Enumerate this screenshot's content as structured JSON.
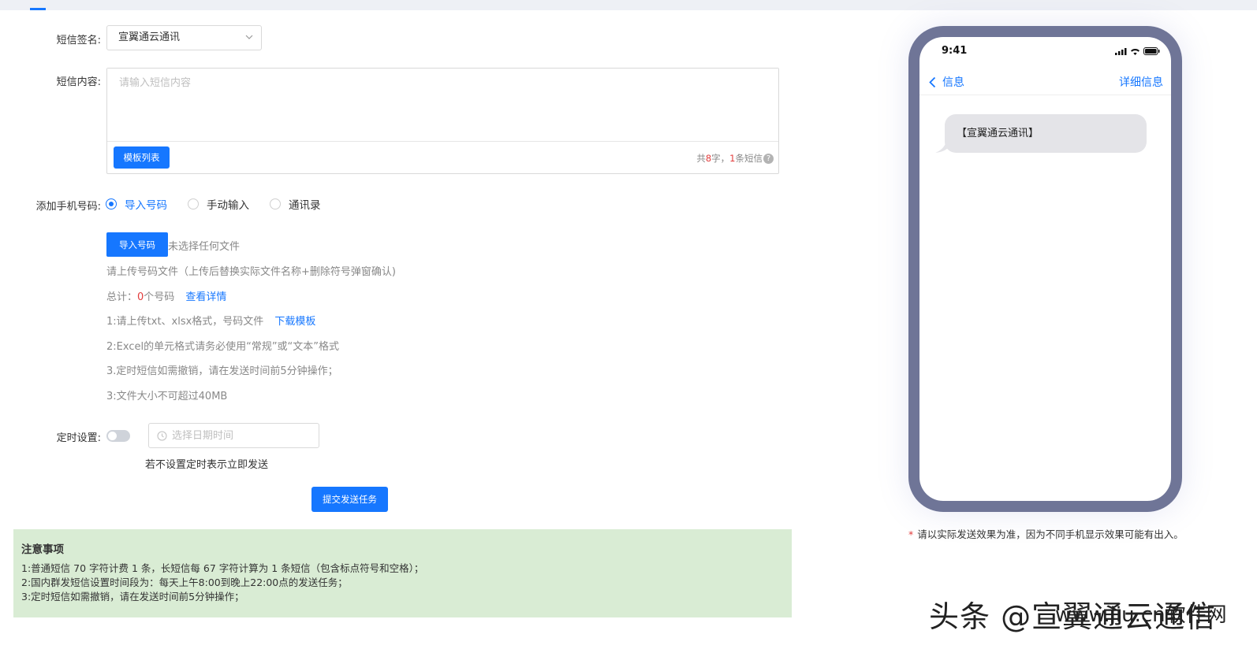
{
  "form": {
    "signature": {
      "label": "短信签名:",
      "value": "宣翼通云通讯"
    },
    "content": {
      "label": "短信内容:",
      "placeholder": "请输入短信内容",
      "template_button": "模板列表",
      "counter": {
        "prefix": "共",
        "chars": "8",
        "mid": " 字，",
        "messages": "1",
        "suffix": " 条短信"
      }
    },
    "phone_numbers": {
      "label": "添加手机号码:",
      "options": [
        {
          "label": "导入号码",
          "checked": true
        },
        {
          "label": "手动输入",
          "checked": false
        },
        {
          "label": "通讯录",
          "checked": false
        }
      ],
      "import_button": "导入号码",
      "no_file": "未选择任何文件",
      "upload_hint": "请上传号码文件（上传后替换实际文件名称+删除符号弹窗确认)",
      "total": {
        "prefix": "总计：",
        "count": "0",
        "suffix": "个号码",
        "link": "查看详情"
      },
      "rule1": {
        "text": "1:请上传txt、xlsx格式，号码文件",
        "link": "下载模板"
      },
      "rule2": "2:Excel的单元格式请务必使用“常规”或“文本”格式",
      "rule3": "3.定时短信如需撤销，请在发送时间前5分钟操作；",
      "rule4": "3:文件大小不可超过40MB"
    },
    "schedule": {
      "label": "定时设置:",
      "placeholder": "选择日期时间",
      "hint": "若不设置定时表示立即发送"
    },
    "submit_button": "提交发送任务"
  },
  "notice": {
    "title": "注意事项",
    "lines": [
      "1:普通短信 70 字符计费 1 条，长短信每 67 字符计算为 1 条短信（包含标点符号和空格）；",
      "2:国内群发短信设置时间段为：每天上午8:00到晚上22:00点的发送任务；",
      "3:定时短信如需撤销，请在发送时间前5分钟操作；"
    ]
  },
  "preview": {
    "time": "9:41",
    "back_label": "信息",
    "detail_label": "详细信息",
    "message": "【宣翼通云通讯】",
    "note_star": "*",
    "note": "请以实际发送效果为准，因为不同手机显示效果可能有出入。"
  },
  "watermark": {
    "text1": "头条 @宣翼通云通信",
    "text2": "www.jiu.cn软件网"
  },
  "colors": {
    "primary": "#1677ff",
    "danger": "#e23b3b",
    "notice_bg": "#d9ecd4",
    "phone_frame": "#6f7597"
  }
}
